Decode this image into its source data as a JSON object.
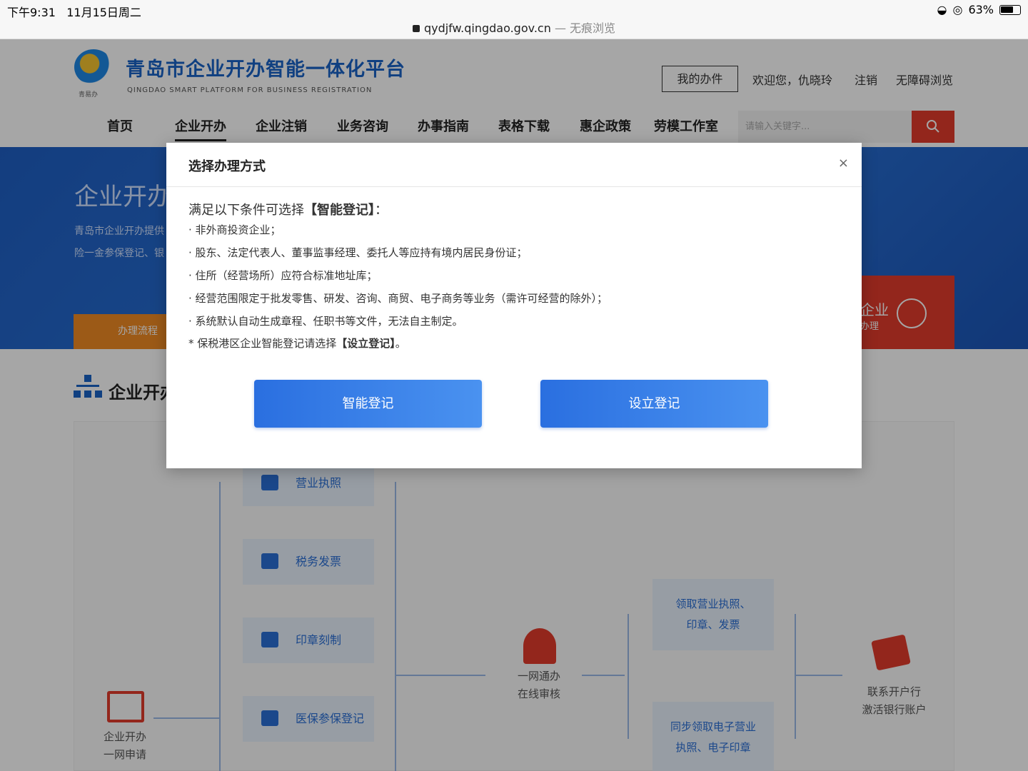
{
  "status_bar": {
    "time": "下午9:31",
    "date": "11月15日周二",
    "battery": "63%",
    "url": "qydjfw.qingdao.gov.cn",
    "mode": " — 无痕浏览"
  },
  "header": {
    "logo_caption": "青易办",
    "site_title": "青岛市企业开办智能一体化平台",
    "site_subtitle": "QINGDAO SMART PLATFORM FOR BUSINESS REGISTRATION",
    "my_tasks": "我的办件",
    "welcome": "欢迎您，仇晓玲",
    "logout": "注销",
    "accessibility": "无障碍浏览",
    "search_placeholder": "请输入关键字..."
  },
  "nav": [
    "首页",
    "企业开办",
    "企业注销",
    "业务咨询",
    "办事指南",
    "表格下载",
    "惠企政策",
    "劳模工作室"
  ],
  "banner": {
    "title": "企业开办",
    "text1": "青岛市企业开办提供",
    "text2": "险一金参保登记、银",
    "tab": "办理流程",
    "card_title": "企业",
    "card_sub": "办理"
  },
  "section": {
    "title": "企业开办"
  },
  "flow": {
    "boxes": [
      "营业执照",
      "税务发票",
      "印章刻制",
      "医保参保登记"
    ],
    "start_line1": "企业开办",
    "start_line2": "一网申请",
    "mid_line1": "一网通办",
    "mid_line2": "在线审核",
    "result1_line1": "领取营业执照、",
    "result1_line2": "印章、发票",
    "result2_line1": "同步领取电子营业",
    "result2_line2": "执照、电子印章",
    "end_line1": "联系开户行",
    "end_line2": "激活银行账户"
  },
  "modal": {
    "title": "选择办理方式",
    "close": "×",
    "cond_prefix": "满足以下条件可选择",
    "cond_highlight": "【智能登记】",
    "cond_suffix": "：",
    "conditions": [
      "· 非外商投资企业；",
      "· 股东、法定代表人、董事监事经理、委托人等应持有境内居民身份证；",
      "· 住所（经营场所）应符合标准地址库；",
      "· 经营范围限定于批发零售、研发、咨询、商贸、电子商务等业务（需许可经营的除外）；",
      "· 系统默认自动生成章程、任职书等文件，无法自主制定。"
    ],
    "note_prefix": "* 保税港区企业智能登记请选择",
    "note_highlight": "【设立登记】",
    "note_suffix": "。",
    "btn_smart": "智能登记",
    "btn_setup": "设立登记"
  }
}
